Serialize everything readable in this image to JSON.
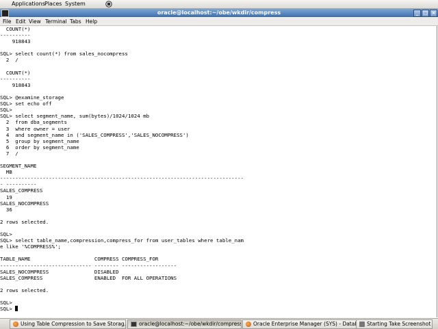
{
  "top_panel": {
    "menus": [
      "Applications",
      "Places",
      "System"
    ],
    "icon": "network-icon"
  },
  "window": {
    "title": "oracle@localhost:~/obe/wkdir/compress",
    "buttons": [
      "minimize-icon",
      "maximize-icon",
      "close-icon"
    ]
  },
  "menubar": {
    "items": [
      "File",
      "Edit",
      "View",
      "Terminal",
      "Tabs",
      "Help"
    ]
  },
  "terminal": {
    "lines": [
      "  COUNT(*)",
      "----------",
      "    918843",
      "",
      "SQL> select count(*) from sales_nocompress",
      "  2  /",
      "",
      "  COUNT(*)",
      "----------",
      "    918843",
      "",
      "SQL> @examine_storage",
      "SQL> set echo off",
      "SQL>",
      "SQL> select segment_name, sum(bytes)/1024/1024 mb",
      "  2  from dba_segments",
      "  3  where owner = user",
      "  4  and segment_name in ('SALES_COMPRESS','SALES_NOCOMPRESS')",
      "  5  group by segment_name",
      "  6  order by segment_name",
      "  7  /",
      "",
      "SEGMENT_NAME",
      "  MB",
      "--------------------------------------------------------------------------------",
      "- ----------",
      "SALES_COMPRESS",
      "  19",
      "SALES_NOCOMPRESS",
      "  36",
      "",
      "2 rows selected.",
      "",
      "SQL>",
      "SQL> select table_name,compression,compress_for from user_tables where table_nam",
      "e like '%COMPRESS%';",
      "",
      "TABLE_NAME                     COMPRESS COMPRESS_FOR",
      "------------------------------ -------- ------------------",
      "SALES_NOCOMPRESS               DISABLED",
      "SALES_COMPRESS                 ENABLED  FOR ALL OPERATIONS",
      "",
      "2 rows selected.",
      "",
      "SQL>",
      "SQL> "
    ]
  },
  "taskbar": {
    "tasks": [
      {
        "label": "Using Table Compression to Save Storag...",
        "icon": "firefox-icon"
      },
      {
        "label": "oracle@localhost:~/obe/wkdir/compress",
        "icon": "terminal-icon"
      },
      {
        "label": "Oracle Enterprise Manager (SYS) - Datab...",
        "icon": "firefox-icon"
      },
      {
        "label": "Starting Take Screenshot",
        "icon": "screenshot-icon"
      }
    ]
  }
}
